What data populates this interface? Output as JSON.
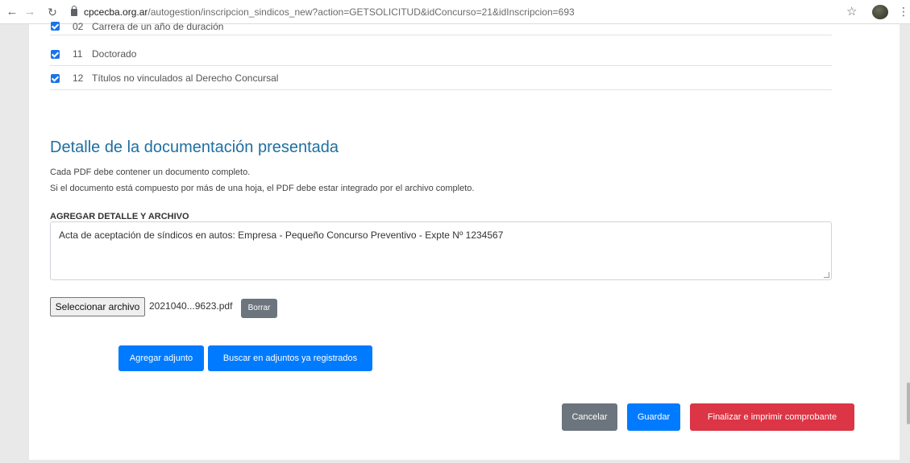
{
  "browser": {
    "url_host": "cpcecba.org.ar",
    "url_path": "/autogestion/inscripcion_sindicos_new?action=GETSOLICITUD&idConcurso=21&idInscripcion=693"
  },
  "checklist": [
    {
      "num": "02",
      "label": "Carrera de un año de duración"
    },
    {
      "num": "11",
      "label": "Doctorado"
    },
    {
      "num": "12",
      "label": "Títulos no vinculados al Derecho Concursal"
    }
  ],
  "section": {
    "title": "Detalle de la documentación presentada",
    "note_1": "Cada PDF debe contener un documento completo.",
    "note_2": "Si el documento está compuesto por más de una hoja, el PDF debe estar integrado por el archivo completo."
  },
  "detail": {
    "label": "AGREGAR DETALLE Y ARCHIVO",
    "value": "Acta de aceptación de síndicos en autos: Empresa - Pequeño Concurso Preventivo - Expte Nº 1234567"
  },
  "file": {
    "choose_label": "Seleccionar archivo",
    "file_name": "2021040...9623.pdf",
    "delete_label": "Borrar"
  },
  "attach_actions": {
    "add_label": "Agregar adjunto",
    "search_label": "Buscar en adjuntos ya registrados"
  },
  "footer_actions": {
    "cancel_label": "Cancelar",
    "save_label": "Guardar",
    "finish_label": "Finalizar e imprimir comprobante"
  },
  "colors": {
    "primary": "#007bff",
    "secondary": "#6c757d",
    "danger": "#dc3545",
    "title": "#1f6fa1"
  }
}
